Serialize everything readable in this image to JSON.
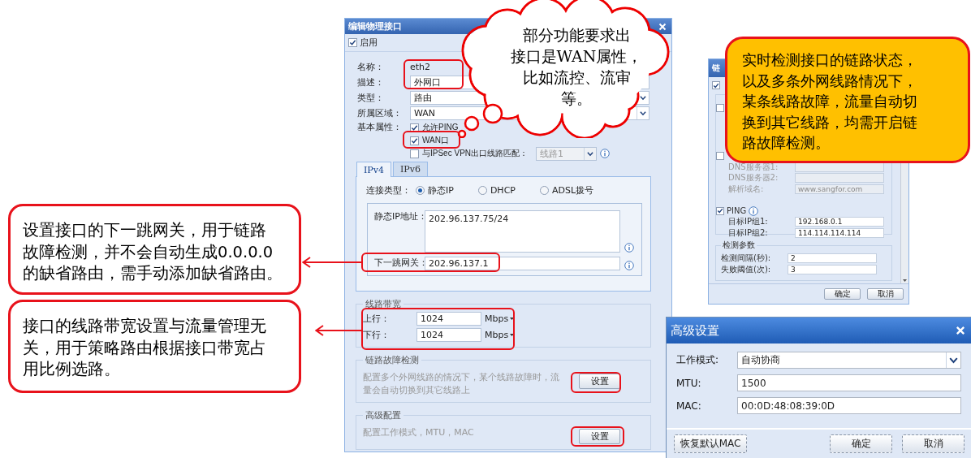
{
  "edit_dialog": {
    "title": "编辑物理接口",
    "enabled": {
      "label": "启用",
      "checked": true
    },
    "fields": [
      {
        "kind": "text",
        "label": "名称：",
        "value": "eth2"
      },
      {
        "kind": "input",
        "label": "描述：",
        "value": "外网口"
      },
      {
        "kind": "select",
        "label": "类型：",
        "value": "路由"
      },
      {
        "kind": "select",
        "label": "所属区域：",
        "value": "WAN"
      }
    ],
    "basic_properties": {
      "label": "基本属性：",
      "options": [
        {
          "label": "允许PING",
          "checked": true
        },
        {
          "label": "WAN口",
          "checked": true
        },
        {
          "label": "与IPSec VPN出口线路匹配：",
          "checked": false,
          "line_select": {
            "value": "线路1",
            "disabled": true
          }
        }
      ]
    },
    "tabs": [
      {
        "label": "IPv4",
        "selected": true
      },
      {
        "label": "IPv6",
        "selected": false
      }
    ],
    "connection_type": {
      "label": "连接类型：",
      "options": [
        {
          "label": "静态IP",
          "selected": true
        },
        {
          "label": "DHCP",
          "selected": false
        },
        {
          "label": "ADSL拨号",
          "selected": false
        }
      ]
    },
    "static_ip": {
      "label": "静态IP地址：",
      "value": "202.96.137.75/24"
    },
    "gateway": {
      "label": "下一跳网关：",
      "value": "202.96.137.1"
    },
    "bandwidth": {
      "title": "线路带宽",
      "rows": [
        {
          "label": "上行：",
          "value": "1024",
          "unit": "Mbps"
        },
        {
          "label": "下行：",
          "value": "1024",
          "unit": "Mbps"
        }
      ]
    },
    "link_detection": {
      "title": "链路故障检测",
      "description": "配置多个外网线路的情况下，某个线路故障时，流量会自动切换到其它线路上",
      "button": "设置"
    },
    "advanced": {
      "title": "高级配置",
      "description": "配置工作模式，MTU，MAC",
      "button": "设置"
    }
  },
  "thought_cloud": {
    "lines": [
      "部分功能要求出",
      "接口是WAN属性，",
      "比如流控、流审",
      "等。"
    ]
  },
  "link_dialog": {
    "title": "链",
    "enabled": {
      "checked": true
    },
    "checkboxes": [
      {
        "checked": false
      },
      {
        "checked": false
      }
    ],
    "dns_rows": [
      {
        "label": "DNS服务器1:",
        "disabled": true
      },
      {
        "label": "DNS服务器2:",
        "disabled": true
      },
      {
        "label": "解析域名:",
        "value": "www.sangfor.com",
        "disabled": true
      }
    ],
    "ping": {
      "label": "PING",
      "checked": true
    },
    "targets": [
      {
        "label": "目标IP组1:",
        "value": "192.168.0.1"
      },
      {
        "label": "目标IP组2:",
        "value": "114.114.114.114"
      }
    ],
    "params": {
      "title": "检测参数",
      "rows": [
        {
          "label": "检测间隔(秒):",
          "value": "2"
        },
        {
          "label": "失败阈值(次):",
          "value": "3"
        }
      ]
    },
    "buttons": [
      "确定",
      "取消"
    ]
  },
  "status_callout": {
    "lines": [
      "实时检测接口的链路状态，",
      "以及多条外网线路情况下，",
      "某条线路故障，流量自动切",
      "换到其它线路，均需开启链",
      "路故障检测。"
    ]
  },
  "gateway_callout": {
    "lines": [
      "设置接口的下一跳网关，用于链路",
      "故障检测，并不会自动生成0.0.0.0",
      "的缺省路由，需手动添加缺省路由。"
    ]
  },
  "bandwidth_callout": {
    "lines": [
      "接口的线路带宽设置与流量管理无",
      "关，用于策略路由根据接口带宽占",
      "用比例选路。"
    ]
  },
  "advanced_dialog": {
    "title": "高级设置",
    "fields": [
      {
        "kind": "select",
        "label": "工作模式:",
        "value": "自动协商"
      },
      {
        "kind": "input",
        "label": "MTU:",
        "value": "1500"
      },
      {
        "kind": "input",
        "label": "MAC:",
        "value": "00:0D:48:08:39:0D"
      }
    ],
    "buttons": [
      "恢复默认MAC",
      "确定",
      "取消"
    ]
  }
}
